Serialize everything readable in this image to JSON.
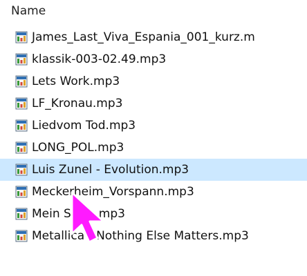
{
  "column": {
    "header": "Name"
  },
  "files": [
    {
      "name": "James_Last_Viva_Espania_001_kurz.m",
      "icon": "audio-file-icon"
    },
    {
      "name": "klassik-003-02.49.mp3",
      "icon": "audio-file-icon"
    },
    {
      "name": "Lets Work.mp3",
      "icon": "audio-file-icon"
    },
    {
      "name": "LF_Kronau.mp3",
      "icon": "audio-file-icon"
    },
    {
      "name": "Liedvom Tod.mp3",
      "icon": "audio-file-icon"
    },
    {
      "name": "LONG_POL.mp3",
      "icon": "audio-file-icon"
    },
    {
      "name": "Luis Zunel - Evolution.mp3",
      "icon": "audio-file-icon",
      "selected": true
    },
    {
      "name": "Meckerheim_Vorspann.mp3",
      "icon": "audio-file-icon"
    },
    {
      "name": "Mein Stern.mp3",
      "icon": "audio-file-icon"
    },
    {
      "name": "Metallica - Nothing Else Matters.mp3",
      "icon": "audio-file-icon"
    }
  ],
  "colors": {
    "selection": "#cce8ff",
    "cursor": "#ff1aff"
  }
}
